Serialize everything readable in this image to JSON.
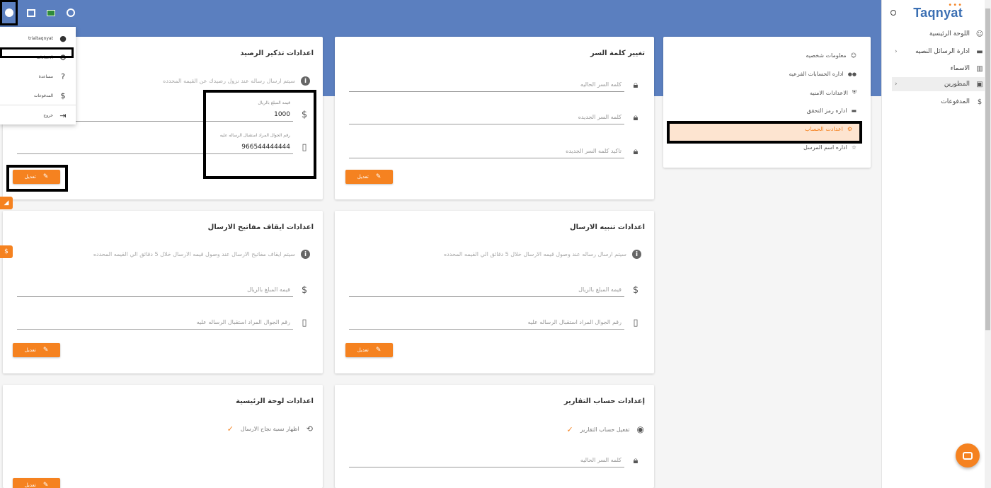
{
  "topbar": {
    "icons": [
      "account-circle-icon",
      "fullscreen-icon",
      "saudi-flag-icon",
      "clock-icon"
    ]
  },
  "dropdown": {
    "username": "trialtaqnyat",
    "items": [
      {
        "label": "الاعدادات",
        "icon": "gear-icon"
      },
      {
        "label": "مساعدة",
        "icon": "help-circle-icon"
      },
      {
        "label": "المدفوعات",
        "icon": "dollar-icon"
      },
      {
        "label": "خروج",
        "icon": "logout-icon"
      }
    ]
  },
  "sidebar": {
    "brand": "Taqnyat",
    "items": [
      {
        "label": "اللوحة الرئيسية",
        "icon": "☺",
        "chevron": false
      },
      {
        "label": "ادارة الرسائل النصيه",
        "icon": "▬",
        "chevron": true
      },
      {
        "label": "الاسماء",
        "icon": "▥",
        "chevron": false
      },
      {
        "label": "المطورين",
        "icon": "▣",
        "chevron": true
      },
      {
        "label": "المدفوعات",
        "icon": "$",
        "chevron": false
      }
    ]
  },
  "account_menu": {
    "items": [
      {
        "label": "معلومات شخصيه",
        "icon": "☺"
      },
      {
        "label": "اداره الحسابات الفرعيه",
        "icon": "👥"
      },
      {
        "label": "الاعدادات الامنيه",
        "icon": "⛨"
      },
      {
        "label": "اداره رمز التحقق",
        "icon": "▬"
      },
      {
        "label": "اعدادت الحساب",
        "icon": "⚙"
      },
      {
        "label": "اداره اسم المرسل",
        "icon": "☆"
      }
    ]
  },
  "password_card": {
    "title": "تغيير كلمة السر",
    "current": "كلمه السر الحاليه",
    "new": "كلمه السر الجديده",
    "confirm": "تاكيد كلمه السر الجديده",
    "button": "تعديل"
  },
  "balance_card": {
    "title": "اعدادات تذكير الرصيد",
    "info": "سيتم ارسال رساله عند نزول رصيدك عن القيمه المحدده",
    "amount_label": "قيمه المبلغ بالريال",
    "amount_value": "1000",
    "phone_label": "رقم الجوال المراد استقبال الرساله عليه",
    "phone_value": "966544444444",
    "button": "تعديل"
  },
  "send_alert_card": {
    "title": "اعدادات تنبيه الارسال",
    "info": "سيتم ارسال رساله عند وصول قيمه الارسال خلال 5 دقائق الي القيمه المحدده",
    "amount": "قيمه المبلغ بالريال",
    "phone": "رقم الجوال المراد استقبال الرساله عليه",
    "button": "تعديل"
  },
  "stop_keys_card": {
    "title": "اعدادات ايقاف مفاتيح الارسال",
    "info": "سيتم ايقاف مفاتيح الارسال عند وصول قيمه الارسال خلال 5 دقائق الي القيمه المحدده",
    "amount": "قيمه المبلغ بالريال",
    "phone": "رقم الجوال المراد استقبال الرساله عليه",
    "button": "تعديل"
  },
  "reports_card": {
    "title": "إعدادات حساب التقارير",
    "toggle": "تفعيل حساب التقارير",
    "password": "كلمه السر الحاليه"
  },
  "dashboard_card": {
    "title": "اعدادات لوحة الرئيسية",
    "toggle": "اظهار نسبة نجاح الارسال",
    "button": "تعديل"
  },
  "colors": {
    "header": "#5b7fbf",
    "accent": "#f58220",
    "brand": "#3b6fb3"
  }
}
